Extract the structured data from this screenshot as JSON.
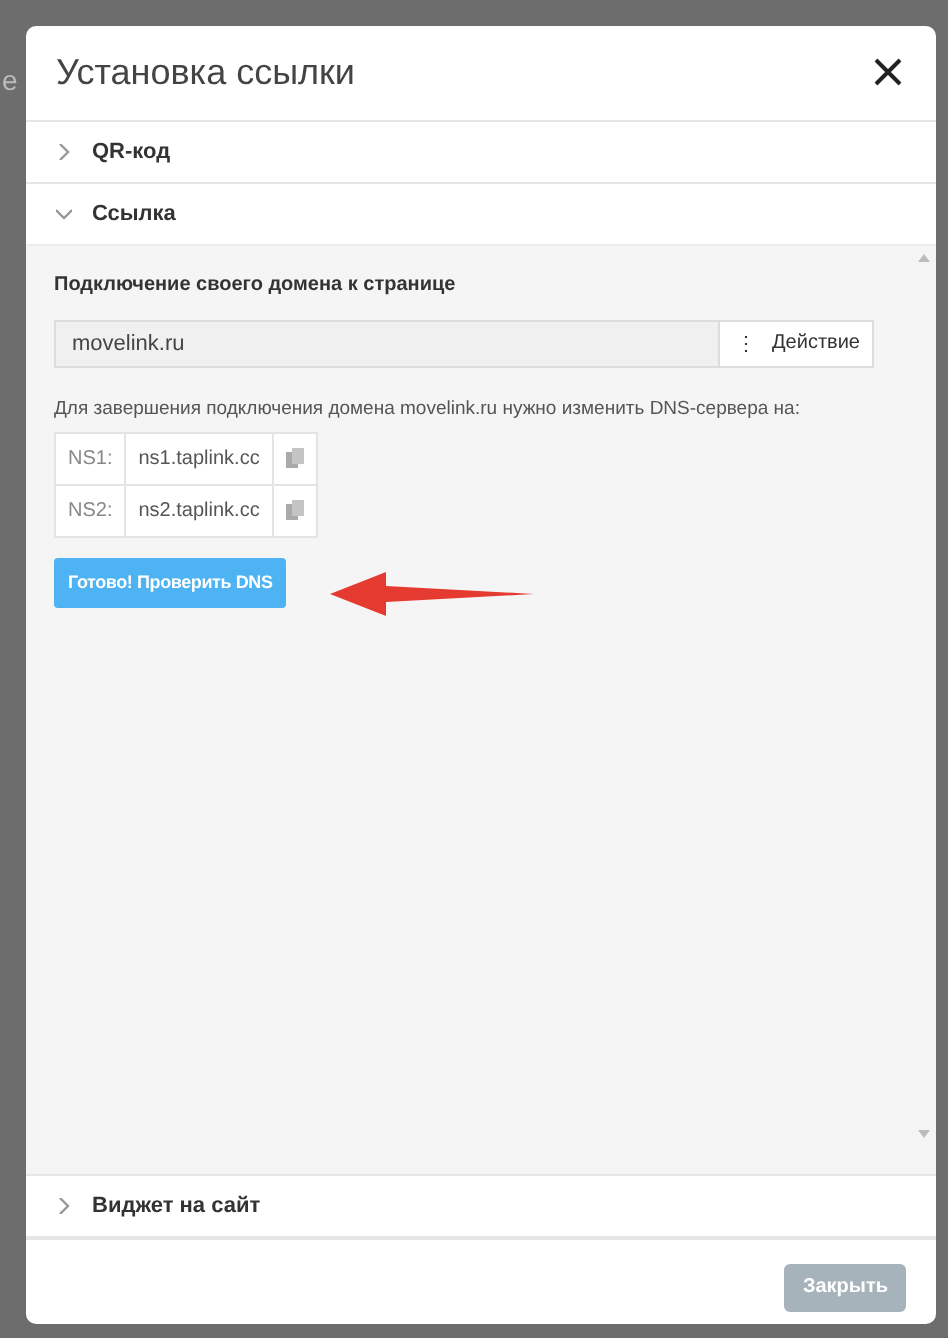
{
  "backdrop_text": "е",
  "dialog": {
    "title": "Установка ссылки",
    "sections": [
      {
        "title": "QR-код",
        "expanded": false
      },
      {
        "title": "Ссылка",
        "expanded": true,
        "content": {
          "heading": "Подключение своего домена к странице",
          "domain_field": {
            "value": "movelink.ru"
          },
          "action_button": {
            "icon": "⋮",
            "label": "Действие"
          },
          "instruction": "Для завершения подключения домена movelink.ru нужно изменить DNS-сервера на:",
          "ns_rows": [
            {
              "label": "NS1:",
              "value": "ns1.taplink.cc"
            },
            {
              "label": "NS2:",
              "value": "ns2.taplink.cc"
            }
          ],
          "check_button": "Готово! Проверить DNS"
        }
      },
      {
        "title": "Виджет на сайт",
        "expanded": false
      }
    ],
    "close_button": {
      "label": "Закрыть",
      "disabled": true
    }
  }
}
